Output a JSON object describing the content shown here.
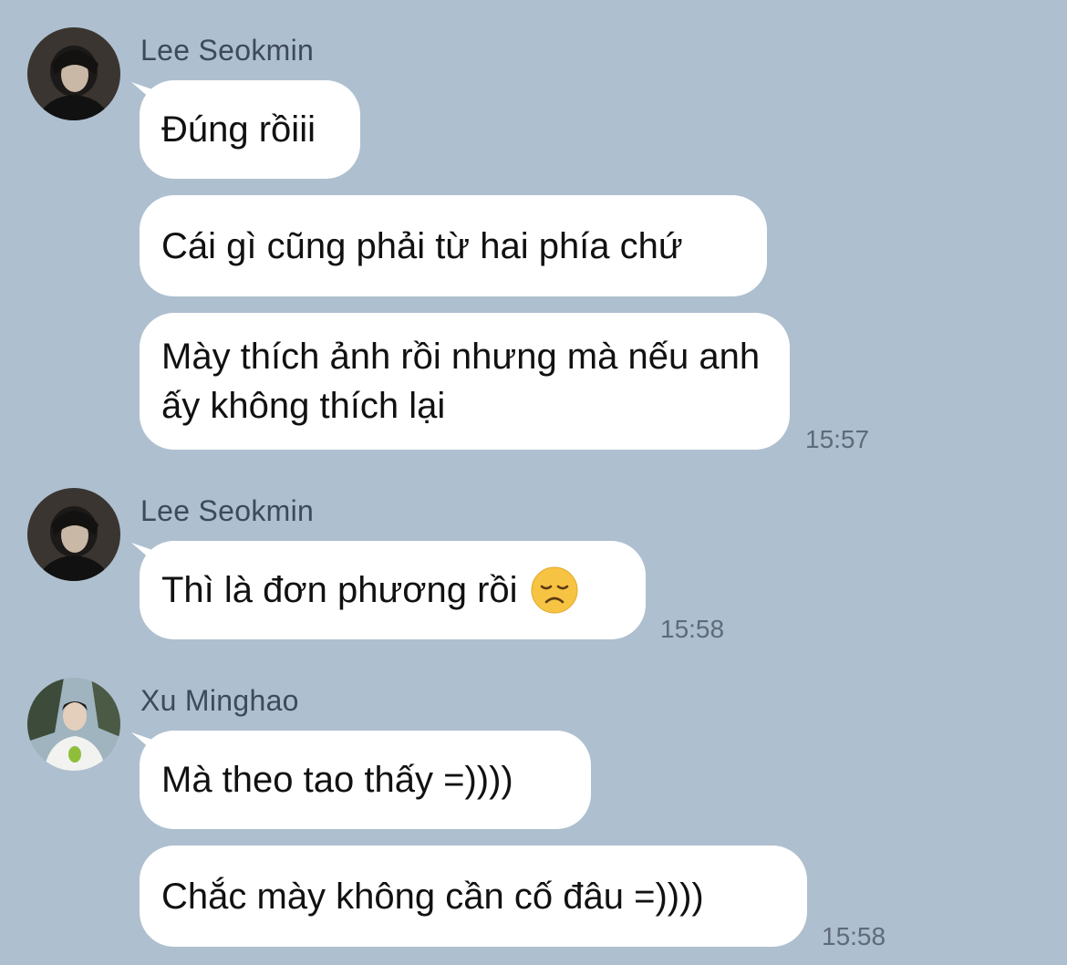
{
  "groups": [
    {
      "sender": "Lee Seokmin",
      "avatar": "seokmin-avatar",
      "messages": [
        "Đúng rồiii",
        "Cái gì cũng phải từ hai phía chứ",
        "Mày thích ảnh rồi nhưng mà nếu anh ấy không thích lại"
      ],
      "time": "15:57"
    },
    {
      "sender": "Lee Seokmin",
      "avatar": "seokmin-avatar",
      "messages": [
        "Thì là đơn phương rồi"
      ],
      "emoji": "disappointed-face",
      "time": "15:58"
    },
    {
      "sender": "Xu Minghao",
      "avatar": "minghao-avatar",
      "messages": [
        "Mà theo tao thấy =))))",
        "Chắc mày không cần cố đâu =))))"
      ],
      "time": "15:58"
    }
  ],
  "colors": {
    "background": "#aebfcf",
    "bubble": "#ffffff",
    "time": "#5e6b79"
  }
}
